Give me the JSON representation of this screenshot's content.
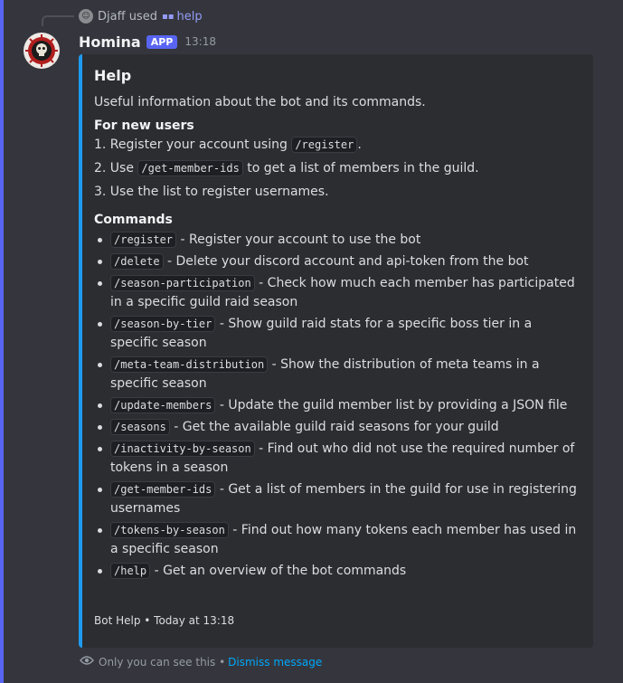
{
  "reply": {
    "user": "Djaff",
    "used": "used",
    "command": "help"
  },
  "message": {
    "author": "Homina",
    "badge": "APP",
    "time": "13:18"
  },
  "embed": {
    "title": "Help",
    "description": "Useful information about the bot and its commands.",
    "new_users_heading": "For new users",
    "steps": [
      {
        "pre": "1. Register your account using ",
        "code": "/register",
        "post": "."
      },
      {
        "pre": "2. Use ",
        "code": "/get-member-ids",
        "post": " to get a list of members in the guild."
      },
      {
        "pre": "3. Use the list to register usernames.",
        "code": "",
        "post": ""
      }
    ],
    "commands_heading": "Commands",
    "commands": [
      {
        "code": "/register",
        "desc": " - Register your account to use the bot"
      },
      {
        "code": "/delete",
        "desc": " - Delete your discord account and api-token from the bot"
      },
      {
        "code": "/season-participation",
        "desc": " - Check how much each member has participated in a specific guild raid season"
      },
      {
        "code": "/season-by-tier",
        "desc": " - Show guild raid stats for a specific boss tier in a specific season"
      },
      {
        "code": "/meta-team-distribution",
        "desc": " - Show the distribution of meta teams in a specific season"
      },
      {
        "code": "/update-members",
        "desc": " - Update the guild member list by providing a JSON file"
      },
      {
        "code": "/seasons",
        "desc": " - Get the available guild raid seasons for your guild"
      },
      {
        "code": "/inactivity-by-season",
        "desc": " - Find out who did not use the required number of tokens in a season"
      },
      {
        "code": "/get-member-ids",
        "desc": " - Get a list of members in the guild for use in registering usernames"
      },
      {
        "code": "/tokens-by-season",
        "desc": " - Find out how many tokens each member has used in a specific season"
      },
      {
        "code": "/help",
        "desc": " - Get an overview of the bot commands"
      }
    ],
    "footer": "Bot Help • Today at 13:18"
  },
  "ephemeral": {
    "text": "Only you can see this •",
    "dismiss": "Dismiss message"
  },
  "colors": {
    "accent": "#5865f2",
    "embed_bar": "#1e9bf0",
    "link": "#00a8fc"
  }
}
